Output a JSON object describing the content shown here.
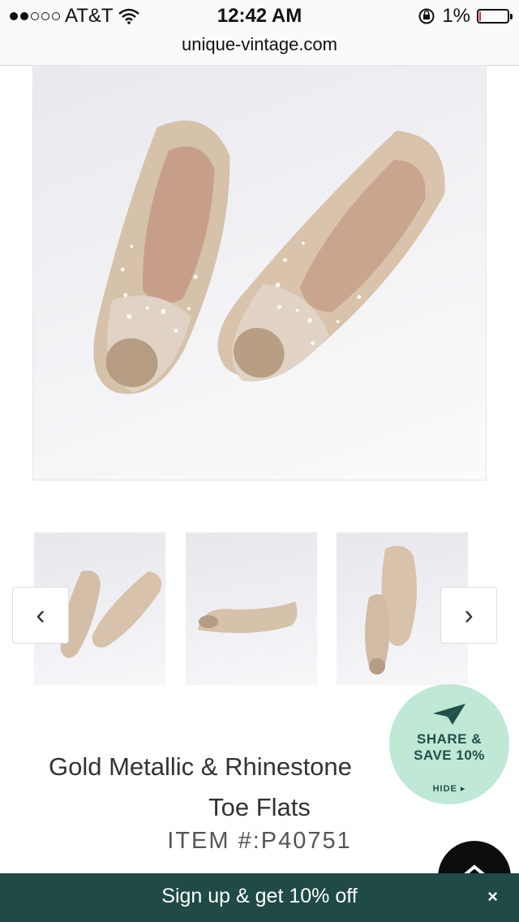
{
  "status_bar": {
    "carrier": "AT&T",
    "time": "12:42 AM",
    "battery_percent": "1%",
    "battery_level": 0.06
  },
  "browser": {
    "url": "unique-vintage.com"
  },
  "gallery": {
    "prev_icon": "chevron-left-icon",
    "next_icon": "chevron-right-icon",
    "prev_glyph": "‹",
    "next_glyph": "›"
  },
  "share_badge": {
    "line1": "SHARE &",
    "line2": "SAVE 10%",
    "hide_label": "HIDE ▸",
    "icon": "paper-plane-icon"
  },
  "product": {
    "title_line1": "Gold Metallic & Rhinestone",
    "title_line2": "Toe Flats",
    "item_number": "ITEM #:P40751"
  },
  "signup_bar": {
    "text": "Sign up & get 10% off",
    "close": "×"
  },
  "colors": {
    "accent_green": "#1f4a45",
    "badge_green": "#bfe8d6",
    "shoe_gold": "#d9c3ad"
  }
}
